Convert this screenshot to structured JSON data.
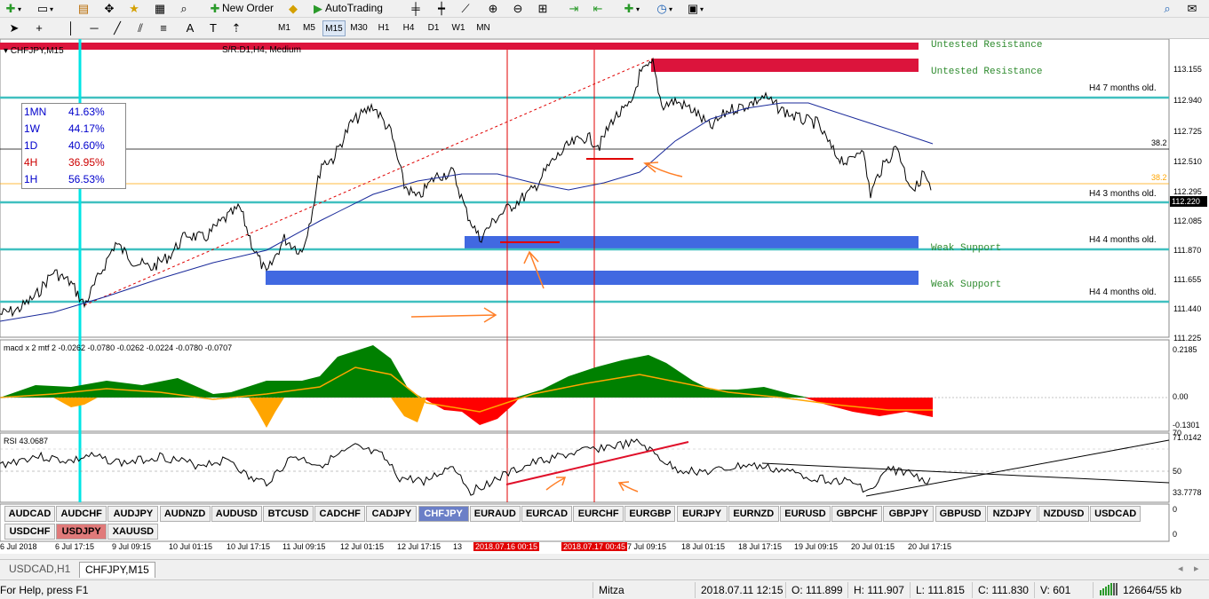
{
  "toolbar": {
    "new_order_label": "New Order",
    "autotrading_label": "AutoTrading",
    "timeframes": [
      "M1",
      "M5",
      "M15",
      "M30",
      "H1",
      "H4",
      "D1",
      "W1",
      "MN"
    ],
    "active_timeframe": "M15"
  },
  "chart": {
    "symbol_caption": "CHFJPY,M15",
    "sr_caption": "S/R:D1,H4, Medium",
    "zones": {
      "untested_1": "Untested Resistance",
      "untested_2": "Untested Resistance",
      "weak_1": "Weak Support",
      "weak_2": "Weak Support",
      "h4_7": "H4 7 months old.",
      "h4_3": "H4 3 months old.",
      "h4_4a": "H4 4 months old.",
      "h4_4b": "H4 4 months old.",
      "fib_1": "38.2",
      "fib_2": "38.2"
    },
    "price_axis": [
      "113.155",
      "112.940",
      "112.725",
      "112.510",
      "112.295",
      "112.085",
      "111.870",
      "111.655",
      "111.440",
      "111.225"
    ],
    "current_price": "112.220",
    "macd_caption": "macd x 2 mtf 2 -0.0262 -0.0780 -0.0262 -0.0224 -0.0780 -0.0707",
    "macd_axis": [
      "0.2185",
      "0.00",
      "-0.1301"
    ],
    "rsi_caption": "RSI 43.0687",
    "rsi_axis": [
      "71.0142",
      "50",
      "33.7778",
      "70"
    ],
    "strength_axis": [
      "0",
      "0"
    ],
    "time_axis": [
      "6 Jul 2018",
      "6 Jul 17:15",
      "9 Jul 09:15",
      "10 Jul 01:15",
      "10 Jul 17:15",
      "11 Jul 09:15",
      "12 Jul 01:15",
      "12 Jul 17:15",
      "13",
      "2018.07.16 00:15",
      "2018.07.17 00:45",
      "7 Jul 09:15",
      "18 Jul 01:15",
      "18 Jul 17:15",
      "19 Jul 09:15",
      "20 Jul 01:15",
      "20 Jul 17:15"
    ]
  },
  "strength_table": [
    {
      "tf": "1MN",
      "value": "41.63%",
      "color": "#0000cc"
    },
    {
      "tf": "1W",
      "value": "44.17%",
      "color": "#0000cc"
    },
    {
      "tf": "1D",
      "value": "40.60%",
      "color": "#0000cc"
    },
    {
      "tf": "4H",
      "value": "36.95%",
      "color": "#cc0000"
    },
    {
      "tf": "1H",
      "value": "56.53%",
      "color": "#0000cc"
    }
  ],
  "symbols_row1": [
    "AUDCAD",
    "AUDCHF",
    "AUDJPY",
    "AUDNZD",
    "AUDUSD",
    "BTCUSD",
    "CADCHF",
    "CADJPY",
    "CHFJPY",
    "EURAUD",
    "EURCAD",
    "EURCHF",
    "EURGBP",
    "EURJPY",
    "EURNZD",
    "EURUSD",
    "GBPCHF",
    "GBPJPY",
    "GBPUSD",
    "NZDJPY",
    "NZDUSD",
    "USDCAD"
  ],
  "symbols_row2": [
    "USDCHF",
    "USDJPY",
    "XAUUSD"
  ],
  "active_symbol": "CHFJPY",
  "highlight_symbol": "USDJPY",
  "tabs": [
    "USDCAD,H1",
    "CHFJPY,M15"
  ],
  "active_tab": "CHFJPY,M15",
  "status": {
    "help": "For Help, press F1",
    "profile": "Mitza",
    "datetime": "2018.07.11 12:15",
    "open": "O: 111.899",
    "high": "H: 111.907",
    "low": "L: 111.815",
    "close": "C: 111.830",
    "volume": "V: 601",
    "traffic": "12664/55 kb"
  },
  "colors": {
    "resistance": "#dc143c",
    "support": "#4169e1",
    "cyan_line": "#40c0c0",
    "zone_text": "#2e8b2e",
    "ma": "#1a2a9a",
    "macd_up": "#008000",
    "macd_down": "#ff0000",
    "macd_orange": "#ffa500",
    "annotation": "#ff7f27"
  }
}
